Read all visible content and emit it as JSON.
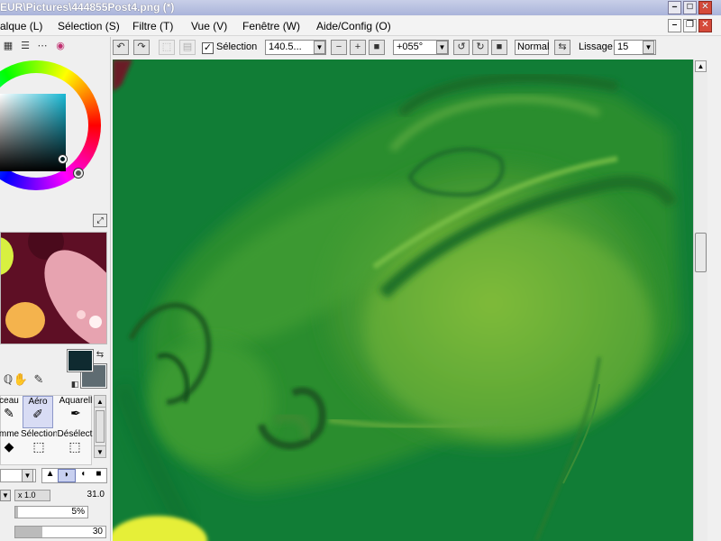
{
  "window": {
    "title": "EUR\\Pictures\\444855Post4.png (*)",
    "controls": {
      "minimize": "–",
      "maximize": "□",
      "close": "✕"
    }
  },
  "menubar": {
    "items": [
      "alque (L)",
      "Sélection (S)",
      "Filtre (T)",
      "Vue (V)",
      "Fenêtre (W)",
      "Aide/Config (O)"
    ],
    "doc_controls": {
      "minimize": "–",
      "restore": "❐",
      "close": "✕"
    }
  },
  "toolbar": {
    "undo_icon": "↶",
    "redo_icon": "↷",
    "deselect_icon": "⬚",
    "crop_icon": "▤",
    "selection_label": "Sélection",
    "selection_checked": true,
    "zoom_value": "140.5...",
    "zoom_out_icon": "−",
    "zoom_in_icon": "+",
    "zoom_reset_icon": "■",
    "rotation_value": "+055°",
    "rotate_ccw_icon": "↺",
    "rotate_cw_icon": "↻",
    "rotate_reset_icon": "■",
    "mode_label": "Normal",
    "flip_icon": "⇆",
    "lissage_label": "Lissage",
    "lissage_value": "15"
  },
  "leftpanel": {
    "view_icons": [
      "▦",
      "☰",
      "⋯",
      "◉"
    ],
    "nav_toggle_icon": "⤢",
    "colors": {
      "foreground": "#0f2a30",
      "background": "#5f6c72",
      "swap_icon": "⇆"
    },
    "tool_icons": [
      "ℚ",
      "✋",
      "✎"
    ],
    "tools": [
      {
        "label": "ceau",
        "icon": "✎"
      },
      {
        "label": "Aéro",
        "icon": "✐",
        "selected": true
      },
      {
        "label": "Aquarell",
        "icon": "✒"
      },
      {
        "label": "mme",
        "icon": "◆"
      },
      {
        "label": "Sélection",
        "icon": "⬚"
      },
      {
        "label": "Désélect",
        "icon": "⬚"
      }
    ],
    "brush_shape_icons": [
      "▲",
      "◗",
      "◖",
      "■"
    ],
    "size_multiplier": "x 1.0",
    "size_value": "31.0",
    "min_size_value": "5%",
    "density_value": "30"
  },
  "colors": {
    "canvas_green": "#117d36",
    "navigator_bg": "#5e0f25",
    "title_blue": "#aab4da"
  }
}
